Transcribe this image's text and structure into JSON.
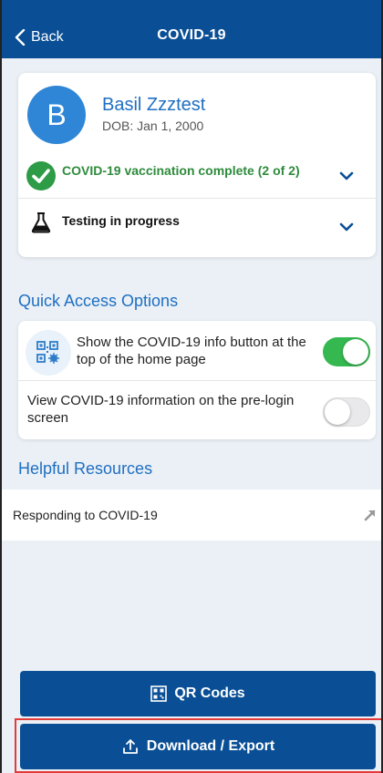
{
  "header": {
    "back_label": "Back",
    "title": "COVID-19"
  },
  "patient": {
    "initial": "B",
    "name": "Basil Zzztest",
    "dob": "DOB: Jan 1, 2000"
  },
  "status": {
    "vaccination": "COVID-19 vaccination complete (2 of 2)",
    "testing": "Testing in progress"
  },
  "quick_access": {
    "title": "Quick Access Options",
    "option1": {
      "label": "Show the COVID-19 info button at the top of the home page",
      "enabled": true
    },
    "option2": {
      "label": "View COVID-19 information on the pre-login screen",
      "enabled": false
    }
  },
  "resources": {
    "title": "Helpful Resources",
    "items": [
      {
        "label": "Responding to COVID-19"
      }
    ]
  },
  "buttons": {
    "qr_label": "QR Codes",
    "export_label": "Download / Export"
  },
  "colors": {
    "brand": "#0a4f95",
    "link": "#1f6fc2",
    "success": "#2e8b3c",
    "toggle_on": "#34b84f"
  }
}
